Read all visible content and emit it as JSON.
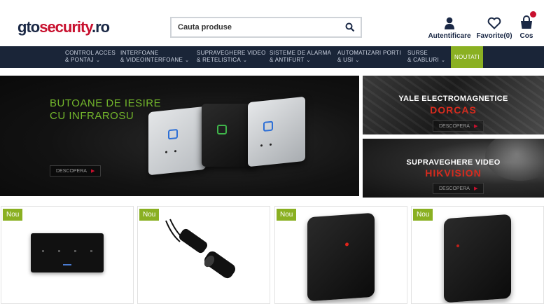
{
  "header": {
    "logo": {
      "part1": "gto",
      "part2": "security",
      "part3": ".ro"
    },
    "search": {
      "placeholder": "Cauta produse"
    },
    "account_label": "Autentificare",
    "favorites_label": "Favorite(0)",
    "cart_label": "Cos"
  },
  "nav": {
    "items": [
      {
        "line1": "CONTROL ACCES",
        "line2": "& PONTAJ"
      },
      {
        "line1": "INTERFOANE",
        "line2": "& VIDEOINTERFOANE"
      },
      {
        "line1": "SUPRAVEGHERE VIDEO",
        "line2": "& RETELISTICA"
      },
      {
        "line1": "SISTEME DE ALARMA",
        "line2": "& ANTIFURT"
      },
      {
        "line1": "AUTOMATIZARI PORTI",
        "line2": "& USI"
      },
      {
        "line1": "SURSE",
        "line2": "& CABLURI"
      }
    ],
    "new_label": "NOUTATI"
  },
  "banners": {
    "main": {
      "title_line1": "BUTOANE DE IESIRE",
      "title_line2": "CU INFRAROSU",
      "cta": "DESCOPERA"
    },
    "side1": {
      "title": "YALE ELECTROMAGNETICE",
      "brand": "DORCAS",
      "cta": "DESCOPERA"
    },
    "side2": {
      "title": "SUPRAVEGHERE VIDEO",
      "brand": "HIKVISION",
      "cta": "DESCOPERA"
    }
  },
  "products": [
    {
      "badge": "Nou"
    },
    {
      "badge": "Nou"
    },
    {
      "badge": "Nou"
    },
    {
      "badge": "Nou"
    }
  ],
  "colors": {
    "navy": "#1a2538",
    "accent_green": "#8ab022",
    "brand_red": "#c8102e"
  }
}
